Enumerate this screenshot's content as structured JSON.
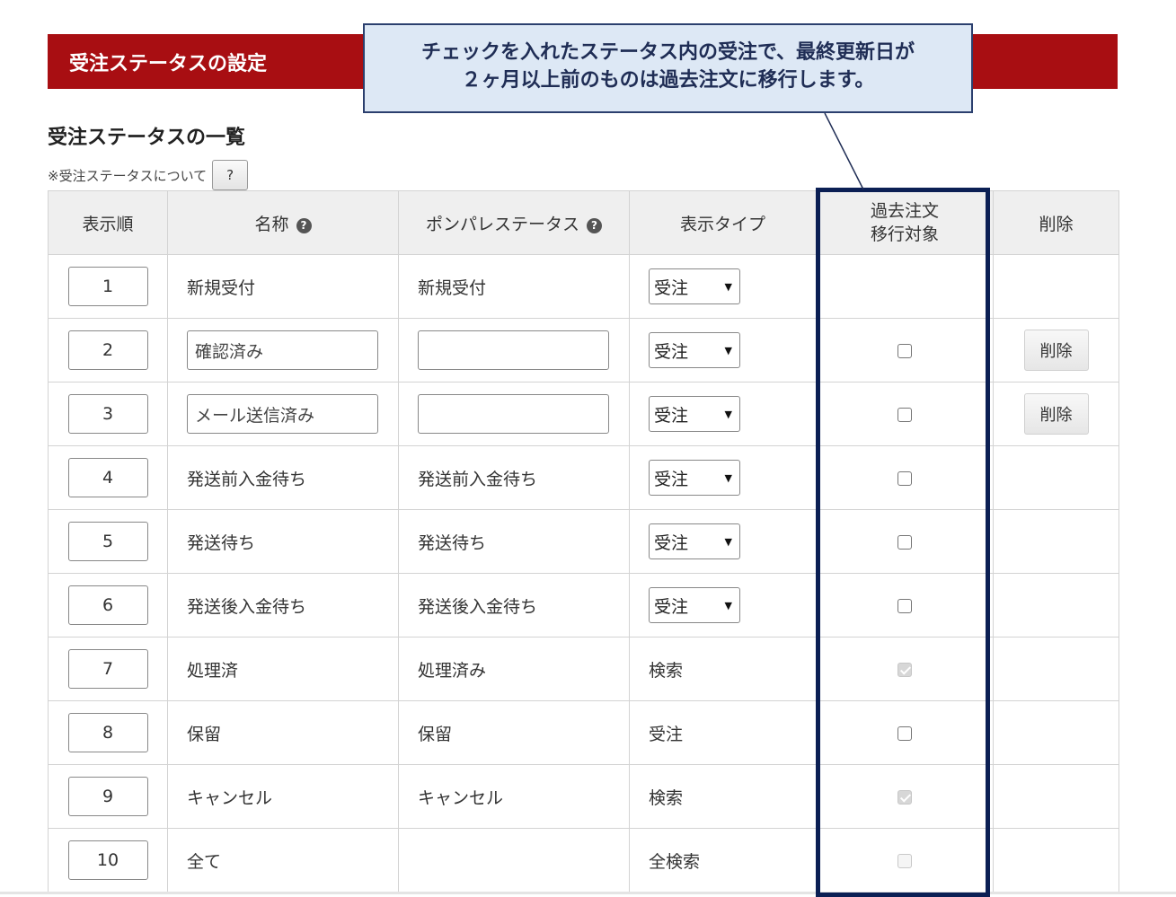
{
  "header": {
    "title": "受注ステータスの設定"
  },
  "callout": {
    "line1": "チェックを入れたステータス内の受注で、最終更新日が",
    "line2": "２ヶ月以上前のものは過去注文に移行します。"
  },
  "section": {
    "title": "受注ステータスの一覧",
    "note": "※受注ステータスについて",
    "help_label": "?"
  },
  "table": {
    "headers": {
      "order": "表示順",
      "name": "名称",
      "pompare": "ポンパレステータス",
      "display_type": "表示タイプ",
      "archive_line1": "過去注文",
      "archive_line2": "移行対象",
      "delete": "削除"
    },
    "help_icon": "?",
    "rows": [
      {
        "order": "1",
        "name": "新規受付",
        "pompare": "新規受付",
        "type": "受注",
        "type_select": true,
        "name_input": false,
        "archive": "none",
        "delete": ""
      },
      {
        "order": "2",
        "name": "確認済み",
        "pompare": "",
        "type": "受注",
        "type_select": true,
        "name_input": true,
        "archive": "unchecked",
        "delete": "削除"
      },
      {
        "order": "3",
        "name": "メール送信済み",
        "pompare": "",
        "type": "受注",
        "type_select": true,
        "name_input": true,
        "archive": "unchecked",
        "delete": "削除"
      },
      {
        "order": "4",
        "name": "発送前入金待ち",
        "pompare": "発送前入金待ち",
        "type": "受注",
        "type_select": true,
        "name_input": false,
        "archive": "unchecked",
        "delete": ""
      },
      {
        "order": "5",
        "name": "発送待ち",
        "pompare": "発送待ち",
        "type": "受注",
        "type_select": true,
        "name_input": false,
        "archive": "unchecked",
        "delete": ""
      },
      {
        "order": "6",
        "name": "発送後入金待ち",
        "pompare": "発送後入金待ち",
        "type": "受注",
        "type_select": true,
        "name_input": false,
        "archive": "unchecked",
        "delete": ""
      },
      {
        "order": "7",
        "name": "処理済",
        "pompare": "処理済み",
        "type": "検索",
        "type_select": false,
        "name_input": false,
        "archive": "checked-disabled",
        "delete": ""
      },
      {
        "order": "8",
        "name": "保留",
        "pompare": "保留",
        "type": "受注",
        "type_select": false,
        "name_input": false,
        "archive": "unchecked",
        "delete": ""
      },
      {
        "order": "9",
        "name": "キャンセル",
        "pompare": "キャンセル",
        "type": "検索",
        "type_select": false,
        "name_input": false,
        "archive": "checked-disabled",
        "delete": ""
      },
      {
        "order": "10",
        "name": "全て",
        "pompare": "",
        "type": "全検索",
        "type_select": false,
        "name_input": false,
        "archive": "disabled",
        "delete": ""
      }
    ]
  },
  "colors": {
    "header_bg": "#a80e12",
    "callout_bg": "#dde8f5",
    "highlight_border": "#0b1f54"
  }
}
